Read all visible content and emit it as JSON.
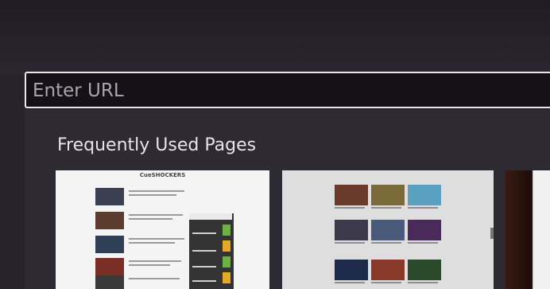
{
  "url_bar": {
    "placeholder": "Enter URL"
  },
  "section": {
    "title": "Frequently Used Pages"
  },
  "pages": [
    {
      "site_name": "CueSHOCKERS"
    },
    {
      "site_name": ""
    },
    {
      "site_name": ""
    }
  ]
}
